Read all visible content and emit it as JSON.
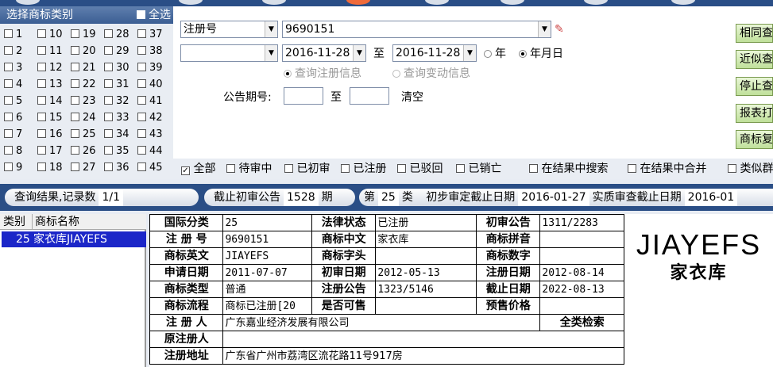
{
  "class_panel": {
    "title": "选择商标类别",
    "select_all": "全选",
    "classes": [
      "1",
      "2",
      "3",
      "4",
      "5",
      "6",
      "7",
      "8",
      "9",
      "10",
      "11",
      "12",
      "13",
      "14",
      "15",
      "16",
      "17",
      "18",
      "19",
      "20",
      "21",
      "22",
      "23",
      "24",
      "25",
      "26",
      "27",
      "28",
      "29",
      "30",
      "31",
      "32",
      "33",
      "34",
      "35",
      "36",
      "37",
      "38",
      "39",
      "40",
      "41",
      "42",
      "43",
      "44",
      "45"
    ]
  },
  "search": {
    "field_type": "注册号",
    "field_value": "9690151",
    "date_field": "",
    "date_from": "2016-11-28",
    "date_to": "2016-11-28",
    "to_label": "至",
    "radio_year": "年",
    "radio_ymd": "年月日",
    "radio_reg_info": "查询注册信息",
    "radio_change_info": "查询变动信息",
    "notice_issue_label": "公告期号:",
    "notice_to_label": "至",
    "clear_label": "清空"
  },
  "buttons": [
    "相同查询",
    "近似查询",
    "停止查询",
    "报表打印",
    "商标复制"
  ],
  "filters": {
    "all": "全部",
    "pending": "待审中",
    "prelim": "已初审",
    "registered": "已注册",
    "rejected": "已驳回",
    "cancelled": "已销亡",
    "search_in_results": "在结果中搜索",
    "merge_in_results": "在结果中合并",
    "similar": "类似群"
  },
  "status": {
    "result_label": "查询结果,记录数",
    "result_count": "1/1",
    "deadline_label": "截止初审公告",
    "deadline_value": "1528",
    "deadline_unit": "期",
    "class_prefix": "第",
    "class_no": "25",
    "class_suffix": "类",
    "prelim_label": "初步审定截止日期",
    "prelim_date": "2016-01-27",
    "substantive_label": "实质审查截止日期",
    "substantive_date": "2016-01"
  },
  "result_list": {
    "col_class": "类别",
    "col_name": "商标名称",
    "rows": [
      {
        "class": "25",
        "name": "家衣库JIAYEFS"
      }
    ]
  },
  "detail": {
    "intl_class_label": "国际分类",
    "intl_class": "25",
    "legal_status_label": "法律状态",
    "legal_status": "已注册",
    "prelim_notice_label": "初审公告",
    "prelim_notice": "1311/2283",
    "reg_no_label": "注 册 号",
    "reg_no": "9690151",
    "cn_name_label": "商标中文",
    "cn_name": "家衣库",
    "pinyin_label": "商标拼音",
    "pinyin": "",
    "en_name_label": "商标英文",
    "en_name": "JIAYEFS",
    "head_label": "商标字头",
    "head": "",
    "digits_label": "商标数字",
    "digits": "",
    "apply_date_label": "申请日期",
    "apply_date": "2011-07-07",
    "prelim_date_label": "初审日期",
    "prelim_date": "2012-05-13",
    "reg_date_label": "注册日期",
    "reg_date": "2012-08-14",
    "type_label": "商标类型",
    "type": "普通",
    "reg_notice_label": "注册公告",
    "reg_notice": "1323/5146",
    "expire_label": "截止日期",
    "expire": "2022-08-13",
    "process_label": "商标流程",
    "process": "商标已注册[20",
    "for_sale_label": "是否可售",
    "for_sale": "",
    "presale_label": "预售价格",
    "presale": "",
    "registrant_label": "注 册 人",
    "registrant": "广东嘉业经济发展有限公司",
    "full_search": "全类检索",
    "orig_registrant_label": "原注册人",
    "orig_registrant": "",
    "address_label": "注册地址",
    "address": "广东省广州市荔湾区流花路11号917房"
  },
  "logo": {
    "en": "JIAYEFS",
    "cn": "家衣库"
  }
}
